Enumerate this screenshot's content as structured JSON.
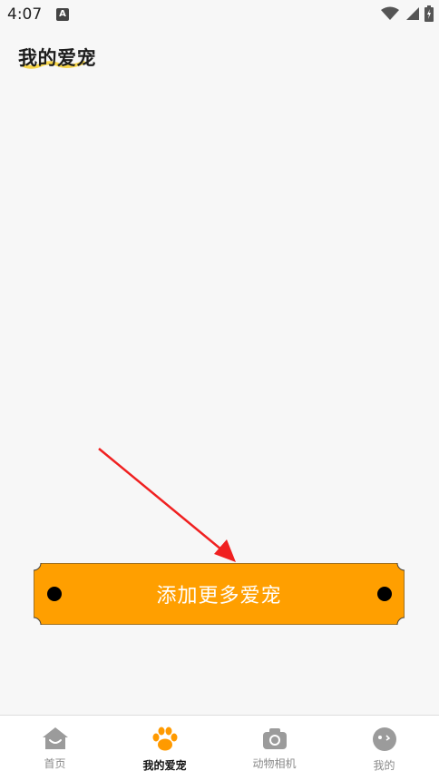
{
  "status_bar": {
    "time": "4:07",
    "notification_badge": "A"
  },
  "page": {
    "title": "我的爱宠"
  },
  "add_button": {
    "label": "添加更多爱宠",
    "color": "#ff9f00"
  },
  "tabbar": {
    "tabs": [
      {
        "label": "首页",
        "icon": "home-icon",
        "active": false
      },
      {
        "label": "我的爱宠",
        "icon": "paw-icon",
        "active": true
      },
      {
        "label": "动物相机",
        "icon": "camera-icon",
        "active": false
      },
      {
        "label": "我的",
        "icon": "profile-face-icon",
        "active": false
      }
    ]
  },
  "colors": {
    "accent": "#ff9f00",
    "active_paw": "#ff9a00",
    "inactive_icon": "#9b9b9b",
    "arrow": "#f02020"
  }
}
